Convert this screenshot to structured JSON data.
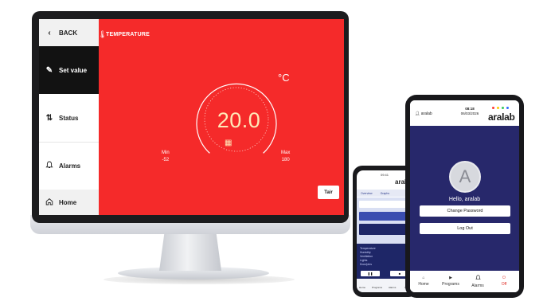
{
  "monitor": {
    "sidebar": {
      "back_label": "BACK",
      "items": [
        {
          "label": "Set value",
          "icon": "pencil-icon"
        },
        {
          "label": "Status",
          "icon": "sort-arrows-icon"
        },
        {
          "label": "Alarms",
          "icon": "bell-icon"
        },
        {
          "label": "Home",
          "icon": "home-icon"
        }
      ]
    },
    "header": {
      "title": "TEMPERATURE",
      "icon": "thermometer-icon"
    },
    "setpoint": {
      "value": "20.0",
      "unit": "°C"
    },
    "range": {
      "min_label": "Min",
      "min_value": "-52",
      "max_label": "Max",
      "max_value": "180"
    },
    "tare_label": "Tair",
    "accent_color": "#f52a2a"
  },
  "phone": {
    "brand": "aralab",
    "time": "09:41",
    "tabs": [
      "Overview",
      "Graphs"
    ],
    "rows": [
      "Temperature",
      "Humidity",
      "Ventilation",
      "Lights",
      "Door/pins"
    ],
    "nav": [
      "Home",
      "Programs",
      "Alarms",
      "Off"
    ]
  },
  "tablet": {
    "user": "aralab",
    "time": "08:18",
    "date": "06/03/2026",
    "brand": "aralab",
    "avatar_letter": "A",
    "greeting": "Hello, aralab",
    "change_password_label": "Change Password",
    "logout_label": "Log Out",
    "nav": [
      {
        "label": "Home",
        "icon": "home-icon"
      },
      {
        "label": "Programs",
        "icon": "play-icon"
      },
      {
        "label": "Alarms",
        "icon": "bell-icon"
      },
      {
        "label": "Off",
        "icon": "power-icon"
      }
    ],
    "header_dot_colors": [
      "#ff3b30",
      "#ffcc00",
      "#34c759",
      "#2f6bff"
    ],
    "body_color": "#27286b"
  }
}
